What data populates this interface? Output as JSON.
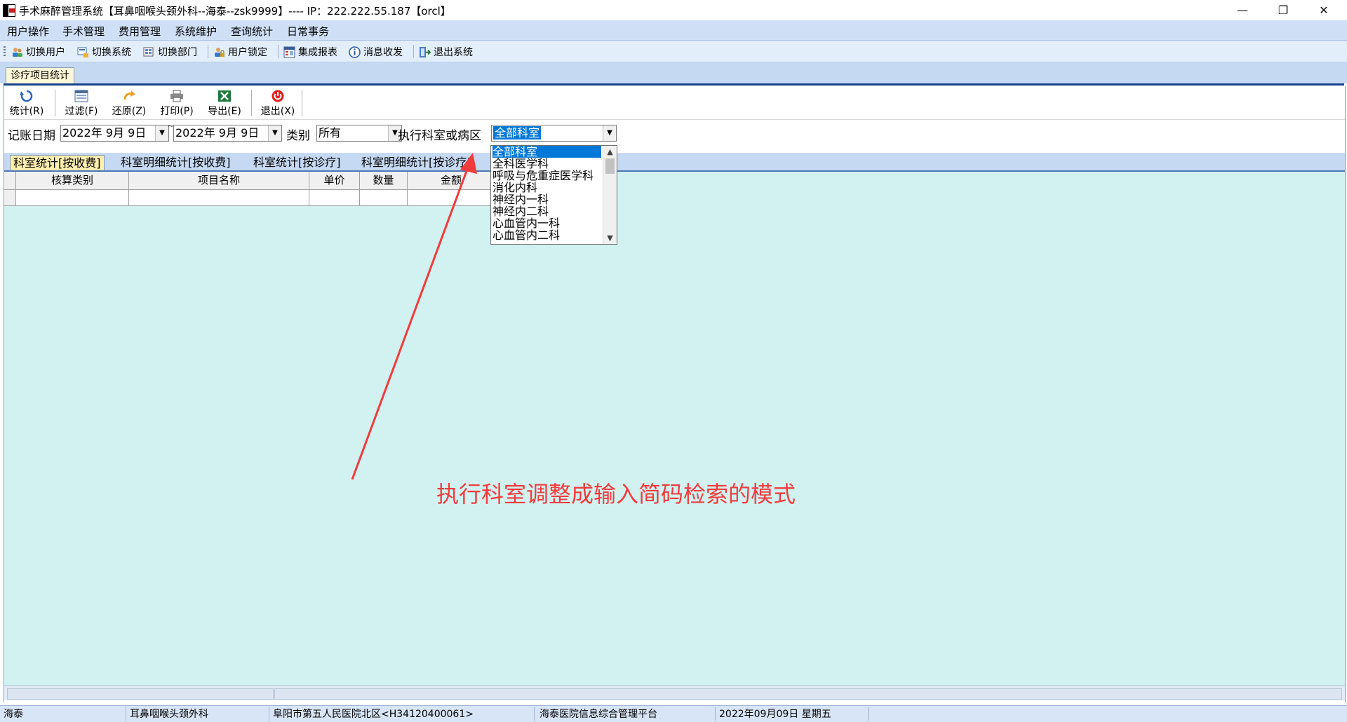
{
  "window": {
    "title": "手术麻醉管理系统【耳鼻咽喉头颈外科--海泰--zsk9999】---- IP：222.222.55.187【orcl】",
    "minimize_glyph": "—",
    "restore_glyph": "❐",
    "close_glyph": "✕"
  },
  "menu": {
    "items": [
      {
        "label": "用户操作"
      },
      {
        "label": "手术管理"
      },
      {
        "label": "费用管理"
      },
      {
        "label": "系统维护"
      },
      {
        "label": "查询统计"
      },
      {
        "label": "日常事务"
      }
    ]
  },
  "toolbar": {
    "items": [
      {
        "label": "切换用户",
        "icon": "users-icon"
      },
      {
        "label": "切换系统",
        "icon": "switch-system-icon"
      },
      {
        "label": "切换部门",
        "icon": "department-icon"
      },
      {
        "label": "用户锁定",
        "icon": "user-lock-icon"
      },
      {
        "label": "集成报表",
        "icon": "report-icon"
      },
      {
        "label": "消息收发",
        "icon": "info-icon"
      },
      {
        "label": "退出系统",
        "icon": "exit-system-icon"
      }
    ]
  },
  "doc_tab": {
    "label": "诊疗项目统计"
  },
  "subtoolbar": {
    "buttons": [
      {
        "label": "统计(R)",
        "icon": "refresh-icon"
      },
      {
        "label": "过滤(F)",
        "icon": "filter-icon"
      },
      {
        "label": "还原(Z)",
        "icon": "undo-icon"
      },
      {
        "label": "打印(P)",
        "icon": "printer-icon"
      },
      {
        "label": "导出(E)",
        "icon": "excel-export-icon"
      },
      {
        "label": "退出(X)",
        "icon": "power-icon"
      }
    ]
  },
  "filters": {
    "date_label": "记账日期",
    "date_from": "2022年 9月 9日",
    "date_separator": "~",
    "date_to": "2022年 9月 9日",
    "category_label": "类别",
    "category_value": "所有",
    "dept_label": "执行科室或病区",
    "dept_value": "全部科室"
  },
  "inner_tabs": [
    {
      "label": "科室统计[按收费]",
      "active": true
    },
    {
      "label": "科室明细统计[按收费]",
      "active": false
    },
    {
      "label": "科室统计[按诊疗]",
      "active": false
    },
    {
      "label": "科室明细统计[按诊疗]",
      "active": false
    }
  ],
  "grid": {
    "columns": [
      "核算类别",
      "项目名称",
      "单价",
      "数量",
      "金额"
    ]
  },
  "dropdown": {
    "options": [
      {
        "label": "全部科室",
        "selected": true
      },
      {
        "label": "全科医学科",
        "selected": false
      },
      {
        "label": "呼吸与危重症医学科",
        "selected": false
      },
      {
        "label": "消化内科",
        "selected": false
      },
      {
        "label": "神经内一科",
        "selected": false
      },
      {
        "label": "神经内二科",
        "selected": false
      },
      {
        "label": "心血管内一科",
        "selected": false
      },
      {
        "label": "心血管内二科",
        "selected": false
      }
    ]
  },
  "annotation": {
    "text": "执行科室调整成输入简码检索的模式",
    "color": "#f23b3b"
  },
  "statusbar": {
    "cells": [
      {
        "text": "海泰"
      },
      {
        "text": "耳鼻咽喉头颈外科"
      },
      {
        "text": "阜阳市第五人民医院北区<H34120400061>"
      },
      {
        "text": "海泰医院信息综合管理平台"
      },
      {
        "text": "2022年09月09日 星期五"
      }
    ]
  },
  "colors": {
    "menubar": "#cfe0f6",
    "grid_background": "#d2f2f2",
    "selection": "#0078d7",
    "active_tab": "#ffefae"
  }
}
